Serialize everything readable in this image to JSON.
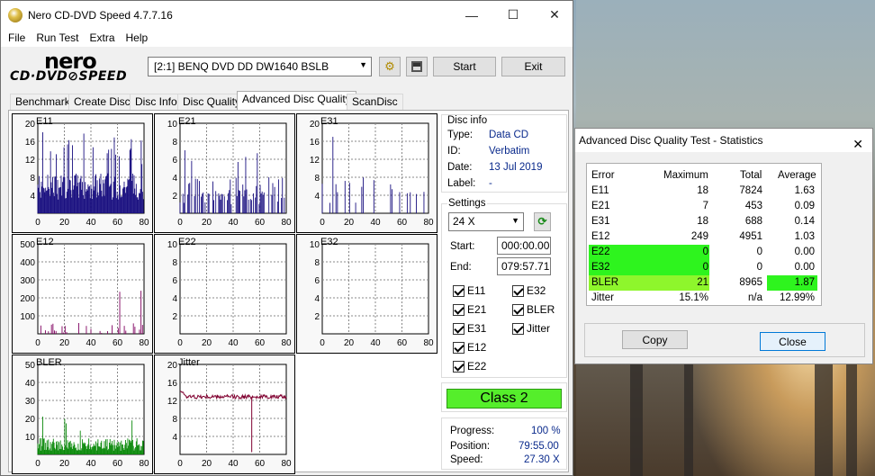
{
  "window": {
    "title": "Nero CD-DVD Speed 4.7.7.16",
    "minimize": "—",
    "maximize": "☐",
    "close": "✕"
  },
  "menu": [
    "File",
    "Run Test",
    "Extra",
    "Help"
  ],
  "logo": {
    "line1": "nero",
    "line2": "CD·DVD⊘SPEED"
  },
  "drive": {
    "selected": "[2:1]   BENQ DVD DD DW1640 BSLB"
  },
  "toolbar": {
    "start_label": "Start",
    "exit_label": "Exit"
  },
  "tabs": [
    "Benchmark",
    "Create Disc",
    "Disc Info",
    "Disc Quality",
    "Advanced Disc Quality",
    "ScanDisc"
  ],
  "active_tab": "Advanced Disc Quality",
  "disc_info": {
    "header": "Disc info",
    "type_label": "Type:",
    "type": "Data CD",
    "id_label": "ID:",
    "id": "Verbatim",
    "date_label": "Date:",
    "date": "13 Jul 2019",
    "label_label": "Label:",
    "label": "-"
  },
  "settings": {
    "header": "Settings",
    "speed": "24 X",
    "start_label": "Start:",
    "start": "000:00.00",
    "end_label": "End:",
    "end": "079:57.71",
    "checks_left": [
      "E11",
      "E21",
      "E31",
      "E12",
      "E22"
    ],
    "checks_right": [
      "E32",
      "BLER",
      "Jitter"
    ]
  },
  "class_badge": "Class 2",
  "progress": {
    "progress_label": "Progress:",
    "progress": "100 %",
    "position_label": "Position:",
    "position": "79:55.00",
    "speed_label": "Speed:",
    "speed": "27.30 X"
  },
  "colors": {
    "navy": "#1a1080",
    "purple": "#800060",
    "green": "#0b8a0b",
    "jitter": "#800030",
    "class_green": "#55ee2b",
    "highlight": "#2ef41e"
  },
  "chart_data": [
    {
      "type": "bar",
      "label": "E11",
      "ylim": [
        0,
        20
      ],
      "yticks": [
        4,
        8,
        12,
        16,
        20
      ],
      "xticks": [
        0,
        20,
        40,
        60,
        80
      ],
      "color": "#1a1080",
      "density": "dense",
      "typical": [
        3,
        9
      ],
      "max": 18
    },
    {
      "type": "bar",
      "label": "E21",
      "ylim": [
        0,
        10
      ],
      "yticks": [
        2,
        4,
        6,
        8,
        10
      ],
      "xticks": [
        0,
        20,
        40,
        60,
        80
      ],
      "color": "#1a1080",
      "density": "medium",
      "typical": [
        1,
        4
      ],
      "max": 7
    },
    {
      "type": "bar",
      "label": "E31",
      "ylim": [
        0,
        20
      ],
      "yticks": [
        4,
        8,
        12,
        16,
        20
      ],
      "xticks": [
        0,
        20,
        40,
        60,
        80
      ],
      "color": "#1a1080",
      "density": "sparse",
      "typical": [
        2,
        10
      ],
      "max": 18
    },
    {
      "type": "bar",
      "label": "E12",
      "ylim": [
        0,
        500
      ],
      "yticks": [
        100,
        200,
        300,
        400,
        500
      ],
      "xticks": [
        0,
        20,
        40,
        60,
        80
      ],
      "color": "#800060",
      "density": "sparse",
      "typical": [
        5,
        60
      ],
      "max": 249
    },
    {
      "type": "bar",
      "label": "E22",
      "ylim": [
        0,
        10
      ],
      "yticks": [
        2,
        4,
        6,
        8,
        10
      ],
      "xticks": [
        0,
        20,
        40,
        60,
        80
      ],
      "color": "#1a1080",
      "density": "none",
      "typical": [
        0,
        0
      ],
      "max": 0
    },
    {
      "type": "bar",
      "label": "E32",
      "ylim": [
        0,
        10
      ],
      "yticks": [
        2,
        4,
        6,
        8,
        10
      ],
      "xticks": [
        0,
        20,
        40,
        60,
        80
      ],
      "color": "#1a1080",
      "density": "none",
      "typical": [
        0,
        0
      ],
      "max": 0
    },
    {
      "type": "bar",
      "label": "BLER",
      "ylim": [
        0,
        50
      ],
      "yticks": [
        10,
        20,
        30,
        40,
        50
      ],
      "xticks": [
        0,
        20,
        40,
        60,
        80
      ],
      "color": "#0b8a0b",
      "density": "dense",
      "typical": [
        2,
        9
      ],
      "max": 21
    },
    {
      "type": "line",
      "label": "Jitter",
      "ylim": [
        0,
        20
      ],
      "yticks": [
        4,
        8,
        12,
        16,
        20
      ],
      "xticks": [
        0,
        20,
        40,
        60,
        80
      ],
      "color": "#800030",
      "start": 14.2,
      "level": 12.8,
      "dip_x": 54,
      "dip_y": 0.5
    }
  ],
  "stats": {
    "title": "Advanced Disc Quality Test - Statistics",
    "headers": [
      "Error",
      "Maximum",
      "Total",
      "Average"
    ],
    "rows": [
      [
        "E11",
        "18",
        "7824",
        "1.63"
      ],
      [
        "E21",
        "7",
        "453",
        "0.09"
      ],
      [
        "E31",
        "18",
        "688",
        "0.14"
      ],
      [
        "E12",
        "249",
        "4951",
        "1.03"
      ],
      [
        "E22",
        "0",
        "0",
        "0.00"
      ],
      [
        "E32",
        "0",
        "0",
        "0.00"
      ],
      [
        "BLER",
        "21",
        "8965",
        "1.87"
      ],
      [
        "Jitter",
        "15.1%",
        "n/a",
        "12.99%"
      ]
    ],
    "copy_label": "Copy",
    "close_label": "Close"
  }
}
